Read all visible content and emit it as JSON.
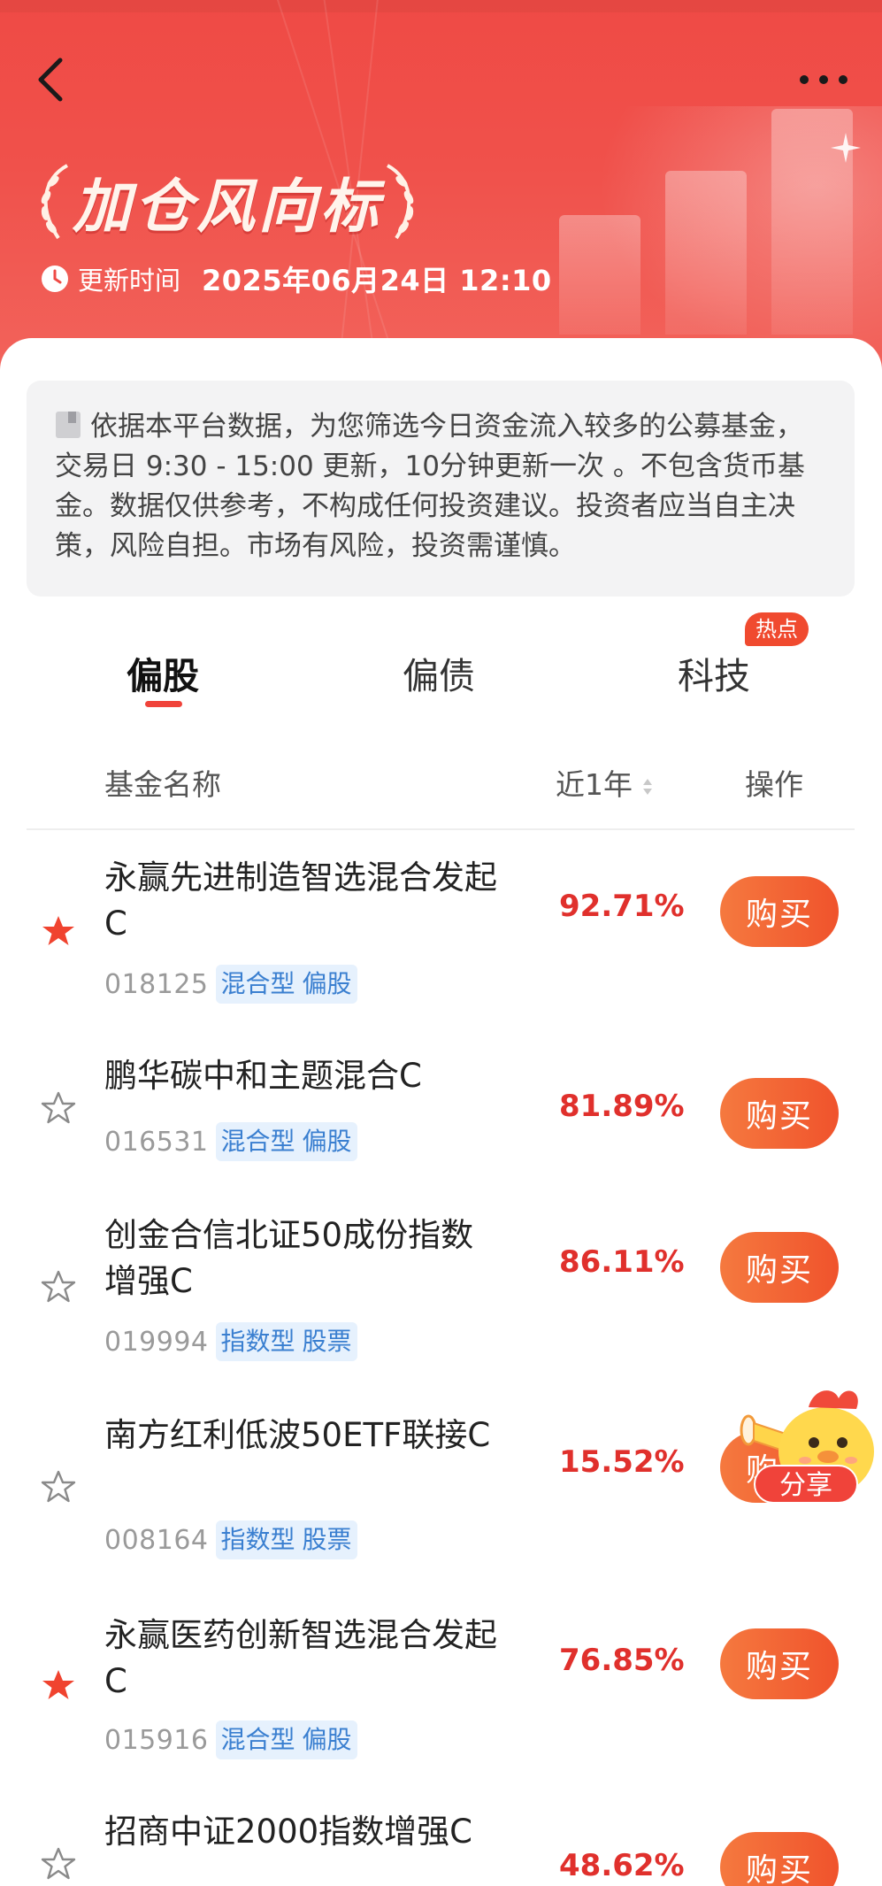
{
  "header": {
    "title": "加仓风向标",
    "update_label": "更新时间",
    "update_time": "2025年06月24日 12:10"
  },
  "notice": {
    "text": "依据本平台数据，为您筛选今日资金流入较多的公募基金，交易日 9:30 - 15:00 更新，10分钟更新一次 。不包含货币基金。数据仅供参考，不构成任何投资建议。投资者应当自主决策，风险自担。市场有风险，投资需谨慎。"
  },
  "tabs": [
    {
      "label": "偏股",
      "active": true
    },
    {
      "label": "偏债",
      "active": false
    },
    {
      "label": "科技",
      "active": false,
      "badge": "热点"
    }
  ],
  "columns": {
    "name": "基金名称",
    "return": "近1年",
    "action": "操作"
  },
  "funds": [
    {
      "name": "永赢先进制造智选混合发起C",
      "code": "018125",
      "tags": [
        "混合型",
        "偏股"
      ],
      "return": "92.71%",
      "starred": true,
      "button": "购买"
    },
    {
      "name": "鹏华碳中和主题混合C",
      "code": "016531",
      "tags": [
        "混合型",
        "偏股"
      ],
      "return": "81.89%",
      "starred": false,
      "button": "购买"
    },
    {
      "name": "创金合信北证50成份指数增强C",
      "code": "019994",
      "tags": [
        "指数型",
        "股票"
      ],
      "return": "86.11%",
      "starred": false,
      "button": "购买"
    },
    {
      "name": "南方红利低波50ETF联接C",
      "code": "008164",
      "tags": [
        "指数型",
        "股票"
      ],
      "return": "15.52%",
      "starred": false,
      "button": "购买"
    },
    {
      "name": "永赢医药创新智选混合发起C",
      "code": "015916",
      "tags": [
        "混合型",
        "偏股"
      ],
      "return": "76.85%",
      "starred": true,
      "button": "购买"
    },
    {
      "name": "招商中证2000指数增强C",
      "code": "",
      "tags": [],
      "return": "48.62%",
      "starred": false,
      "button": "购买"
    }
  ],
  "share": {
    "label": "分享"
  },
  "colors": {
    "brand_red": "#ef4a45",
    "return_red": "#e0302c",
    "buy_orange": "#f5793f",
    "tag_blue": "#3a7fd0",
    "tag_bg": "#e6f1fd"
  }
}
